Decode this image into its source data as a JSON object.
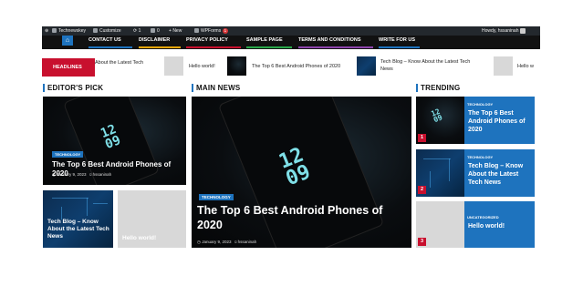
{
  "admin_bar": {
    "site_name": "Technewskey",
    "customize": "Customize",
    "updates": "1",
    "comments": "0",
    "new": "New",
    "wpforms": "WPForms",
    "wpforms_count": "1",
    "howdy": "Howdy, hssaninah"
  },
  "nav": {
    "items": [
      "CONTACT US",
      "DISCLAIMER",
      "PRIVACY POLICY",
      "SAMPLE PAGE",
      "TERMS AND CONDITIONS",
      "WRITE FOR US"
    ],
    "accent_colors": [
      "#1e73be",
      "#e5a50a",
      "#c8102e",
      "#2aa74a",
      "#8e44ad",
      "#1e73be"
    ]
  },
  "ticker": {
    "label": "HEADLINES",
    "items": [
      "About the Latest Tech",
      "Hello world!",
      "The Top 6 Best Android Phones of 2020",
      "Tech Blog – Know About the Latest Tech News",
      "Hello w"
    ]
  },
  "sections": {
    "editors_pick": "EDITOR'S PICK",
    "main_news": "MAIN NEWS",
    "trending": "TRENDING"
  },
  "editors_pick": {
    "feature": {
      "tag": "TECHNOLOGY",
      "title": "The Top 6 Best Android Phones of 2020",
      "date": "January 9, 2023",
      "author": "hssaninah"
    },
    "small": [
      {
        "title": "Tech Blog – Know About the Latest Tech News"
      },
      {
        "title": "Hello world!"
      }
    ]
  },
  "main_news": {
    "tag": "TECHNOLOGY",
    "title": "The Top 6 Best Android Phones of 2020",
    "date": "January 9, 2023",
    "author": "hssaninah"
  },
  "trending": [
    {
      "num": "1",
      "tag": "TECHNOLOGY",
      "title": "The Top 6 Best Android Phones of 2020"
    },
    {
      "num": "2",
      "tag": "TECHNOLOGY",
      "title": "Tech Blog – Know About the Latest Tech News"
    },
    {
      "num": "3",
      "tag": "UNCATEGORIZED",
      "title": "Hello world!"
    }
  ],
  "colors": {
    "accent": "#1e73be",
    "headline_red": "#c8102e",
    "admin_bg": "#23282d"
  }
}
